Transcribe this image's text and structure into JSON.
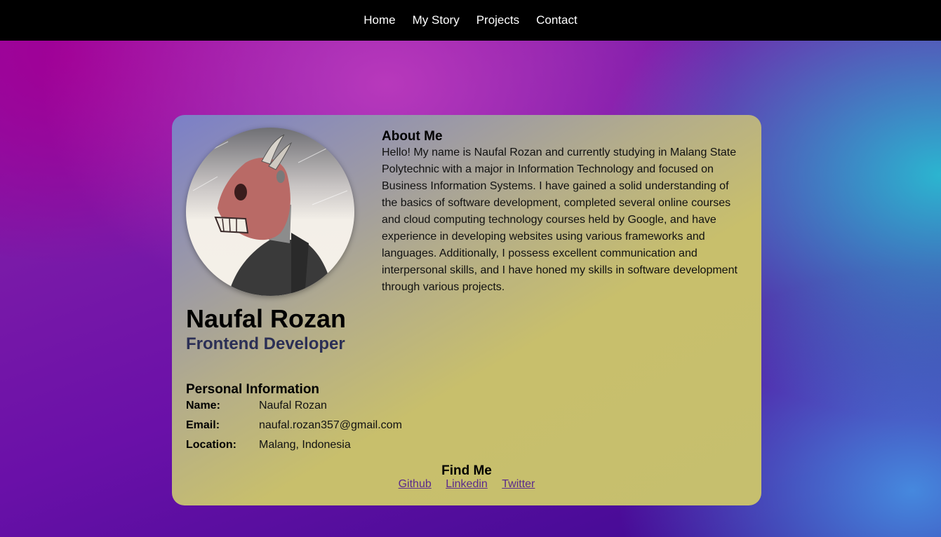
{
  "nav": {
    "items": [
      {
        "label": "Home"
      },
      {
        "label": "My Story"
      },
      {
        "label": "Projects"
      },
      {
        "label": "Contact"
      }
    ]
  },
  "profile": {
    "avatar_icon": "masked-character-avatar",
    "name": "Naufal Rozan",
    "role": "Frontend Developer"
  },
  "about": {
    "title": "About Me",
    "text": "Hello! My name is Naufal Rozan and currently studying in Malang State Polytechnic with a major in Information Technology and focused on Business Information Systems. I have gained a solid understanding of the basics of software development, completed several online courses and cloud computing technology courses held by Google, and have experience in developing websites using various frameworks and languages. Additionally, I possess excellent communication and interpersonal skills, and I have honed my skills in software development through various projects."
  },
  "personal": {
    "title": "Personal Information",
    "rows": [
      {
        "label": "Name:",
        "value": "Naufal Rozan"
      },
      {
        "label": "Email:",
        "value": "naufal.rozan357@gmail.com"
      },
      {
        "label": "Location:",
        "value": "Malang, Indonesia"
      }
    ]
  },
  "find": {
    "title": "Find Me",
    "links": [
      {
        "label": "Github"
      },
      {
        "label": "Linkedin"
      },
      {
        "label": "Twitter"
      }
    ]
  },
  "colors": {
    "navbar": "#000000",
    "link": "#5a2a8c",
    "role": "#2b2f55"
  }
}
